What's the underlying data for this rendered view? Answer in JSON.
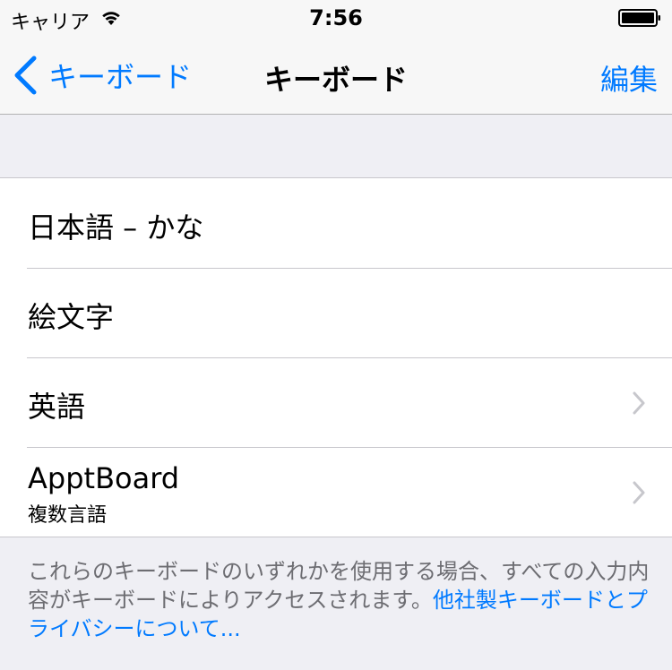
{
  "status_bar": {
    "carrier": "キャリア",
    "time": "7:56",
    "icons": [
      "wifi-icon",
      "battery-icon"
    ]
  },
  "nav": {
    "back_label": "キーボード",
    "title": "キーボード",
    "edit_label": "編集",
    "icons": [
      "chevron-left-icon"
    ]
  },
  "keyboards": [
    {
      "label": "日本語 – かな"
    },
    {
      "label": "絵文字"
    },
    {
      "label": "英語",
      "icon": "chevron-right-icon"
    },
    {
      "label": "ApptBoard",
      "sublabel": "複数言語",
      "icon": "chevron-right-icon"
    }
  ],
  "footer": {
    "text": "これらのキーボードのいずれかを使用する場合、すべての入力内容がキーボードによりアクセスされます。",
    "link": "他社製キーボードとプライバシーについて..."
  },
  "colors": {
    "accent": "#007aff",
    "background": "#efeff4",
    "separator": "#c8c7cc",
    "footer_text": "#6d6d72"
  }
}
